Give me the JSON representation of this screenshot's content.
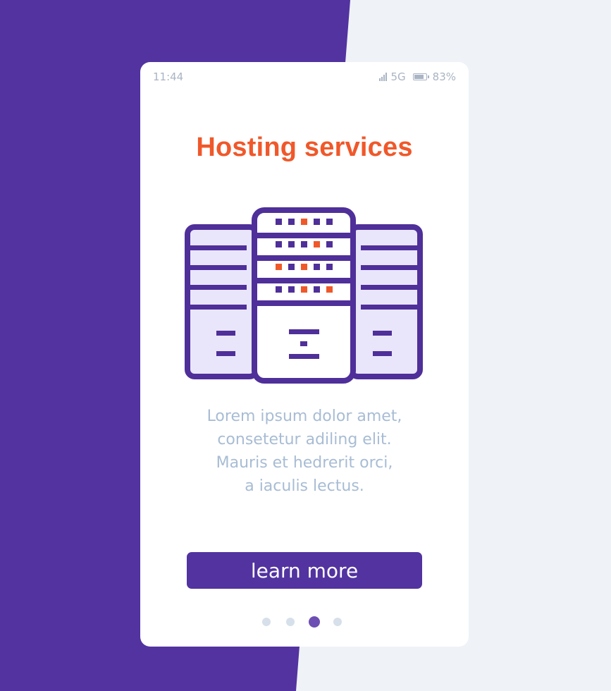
{
  "status_bar": {
    "time": "11:44",
    "signal_icon": "signal-bars-icon",
    "network": "5G",
    "battery_icon": "battery-icon",
    "battery_percent": "83%",
    "battery_level": 0.83
  },
  "onboarding": {
    "title": "Hosting services",
    "illustration": "server-rack-icon",
    "description_lines": [
      "Lorem ipsum dolor amet,",
      "consetetur adiling elit.",
      "Mauris et hedrerit orci,",
      "a iaculis lectus."
    ],
    "cta_label": "learn more"
  },
  "pagination": {
    "total_pages": 4,
    "current_page": 3
  },
  "colors": {
    "brand_purple": "#5233a0",
    "accent_orange": "#f0582a",
    "text_muted": "#a8bcd4",
    "server_fill_light": "#e9e6fb",
    "dot_inactive": "#d6e0ea",
    "dot_active": "#6d4fb3",
    "page_background": "#eff2f7"
  }
}
